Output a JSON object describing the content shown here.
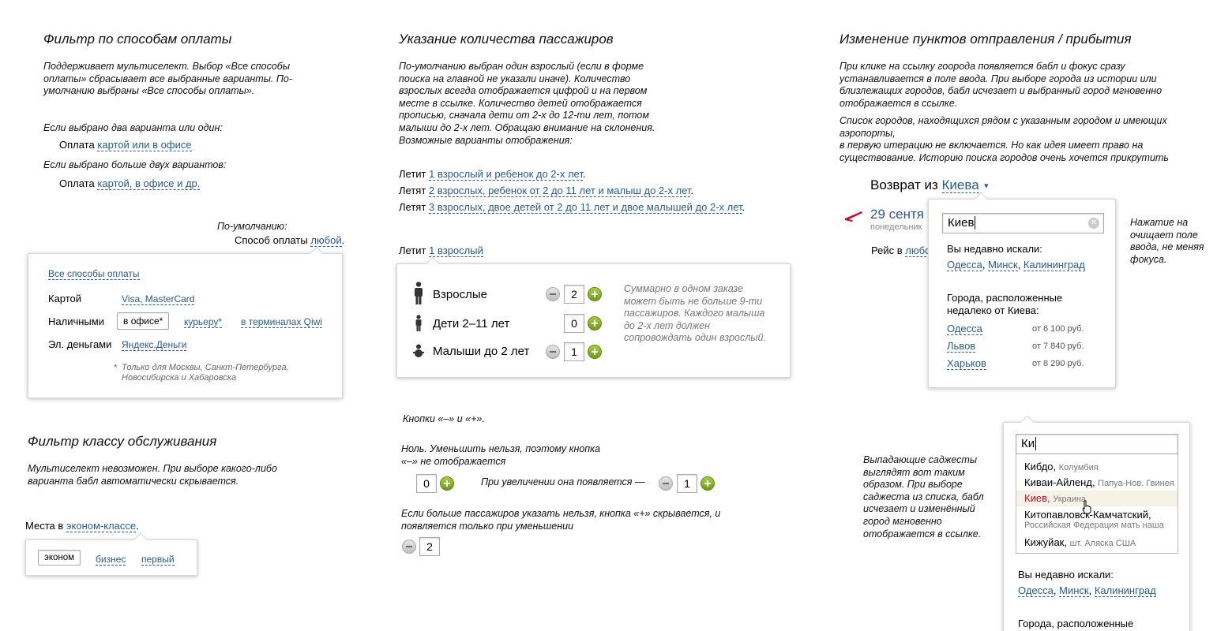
{
  "payment": {
    "title": "Фильтр по способам оплаты",
    "desc": "Поддерживает мультиселект. Выбор «Все способы оплаты» сбрасывает все выбранные варианты. По-умолчанию выбраны «Все способы оплаты».",
    "if_two": "Если выбрано два варианта или один:",
    "ex1_prefix": "Оплата",
    "ex1_link": "картой или в офисе",
    "if_more": "Если выбрано больше двух вариантов:",
    "ex2_prefix": "Оплата",
    "ex2_link": "картой, в офисе и др.",
    "default_note": "По-умолчанию:",
    "default_prefix": "Способ оплаты",
    "default_link": "любой",
    "default_dot": ".",
    "all_link": "Все способы оплаты",
    "card_label": "Картой",
    "card_link": "Visa, MasterCard",
    "cash_label": "Наличными",
    "cash_office": "в офисе*",
    "cash_courier": "курьеру*",
    "cash_qiwi": "в терминалах Qiwi",
    "emoney_label": "Эл. деньгами",
    "emoney_link": "Яндекс.Деньги",
    "footnote_star": "*",
    "footnote": "Только для Москвы, Санкт-Петербурга, Новосибирска и Хабаровска"
  },
  "class_filter": {
    "title": "Фильтр классу обслуживания",
    "desc": "Мультиселект невозможен. При выборе какого-либо варианта бабл автоматически скрывается.",
    "prefix": "Места в",
    "link": "эконом-классе",
    "dot": ".",
    "options": [
      "эконом",
      "бизнес",
      "первый"
    ]
  },
  "passengers": {
    "title": "Указание количества пассажиров",
    "desc": "По-умолчанию выбран один взрослый (если в форме поиска на главной не указали иначе). Количество взрослых всегда отображается цифрой и на первом месте в ссылке. Количество детей отображается прописью, сначала дети от 2-х до 12-ти лет, потом малыши до 2-х лет. Обращаю внимание на склонения. Возможные варианты отображения:",
    "examples": [
      {
        "prefix": "Летит",
        "link": "1 взрослый и ребенок до 2-х лет",
        "suffix": "."
      },
      {
        "prefix": "Летят",
        "link": "2 взрослых, ребенок от 2 до 11 лет и малыш до 2-х лет",
        "suffix": "."
      },
      {
        "prefix": "Летят",
        "link": "3 взрослых, двое детей от 2 до 11 лет и двое малышей до 2-х лет",
        "suffix": "."
      }
    ],
    "current_prefix": "Летит",
    "current_link": "1 взрослый",
    "rows": [
      {
        "label": "Взрослые",
        "value": "2"
      },
      {
        "label": "Дети 2–11 лет",
        "value": "0"
      },
      {
        "label": "Малыши до 2 лет",
        "value": "1"
      }
    ],
    "side_note": "Суммарно в одном заказе может быть не больше 9-ти пассажиров. Каждого малыша до 2-х лет должен сопровождать один взрослый.",
    "buttons_note": "Кнопки «–» и «+».",
    "zero_note": "Ноль. Уменьшить нельзя, поэтому кнопка «–» не отображается",
    "zero_value": "0",
    "increase_note": "При увеличении она появляется —",
    "increase_value": "1",
    "max_note": "Если больше пассажиров указать нельзя, кнопка «+» скрывается, и появляется только при уменьшении",
    "max_value": "2"
  },
  "cities": {
    "title": "Изменение пунктов отправления / прибытия",
    "desc1": "При клике на ссылку гоорода появляется бабл и фокус сразу устанавливается в поле ввода. При выборе города из истории или близлежащих городов, бабл исчезает и выбранный город мгновенно отображается в ссылке.",
    "desc2": "Список городов, находящихся рядом с указанным городом и имеющих аэропорты,",
    "desc3": "в первую итерацию не включается. Но как идея имеет право на существование. Историю поиска городов очень хочется прикрутить",
    "return_prefix": "Возврат из",
    "return_link": "Киева",
    "date": "29 сентя",
    "weekday": "понедельник",
    "flight_prefix": "Рейс в",
    "flight_link": "любо",
    "input_value": "Киев",
    "recent_label": "Вы недавно искали:",
    "recent": [
      "Одесса",
      "Минск",
      "Калининград"
    ],
    "near_label": "Города, расположенные недалеко от Киева:",
    "near": [
      {
        "city": "Одесса",
        "price": "от 6 100 руб."
      },
      {
        "city": "Львов",
        "price": "от 7 840 руб."
      },
      {
        "city": "Харьков",
        "price": "от 8 290 руб."
      }
    ],
    "clear_note": "Нажатие на очищает поле ввода, не меняя фокуса.",
    "suggest_note": "Выпадающие саджесты выглядят вот таким образом. При выборе саджеста из списка, бабл исчезает и изменённый город мгновенно отображается в ссылке.",
    "suggest_input": "Ки",
    "suggestions": [
      {
        "city": "Кибдо",
        "country": "Колумбия"
      },
      {
        "city": "Киваи-Айленд",
        "country": "Папуа-Нов. Гвинея"
      },
      {
        "city": "Киев",
        "country": "Украина"
      },
      {
        "city": "Китопавловск-Камчатский",
        "country": "Российская Федерация мать наша"
      },
      {
        "city": "Кижуйак",
        "country": "шт. Аляска США"
      }
    ],
    "recent2_label": "Вы недавно искали:",
    "recent2": [
      "Одесса",
      "Минск",
      "Калининград"
    ],
    "near2_label": "Города, расположенные"
  },
  "colors": {
    "link": "#2a5a8c",
    "accent_red": "#c0102c",
    "plus_green": "#7aab1c"
  }
}
